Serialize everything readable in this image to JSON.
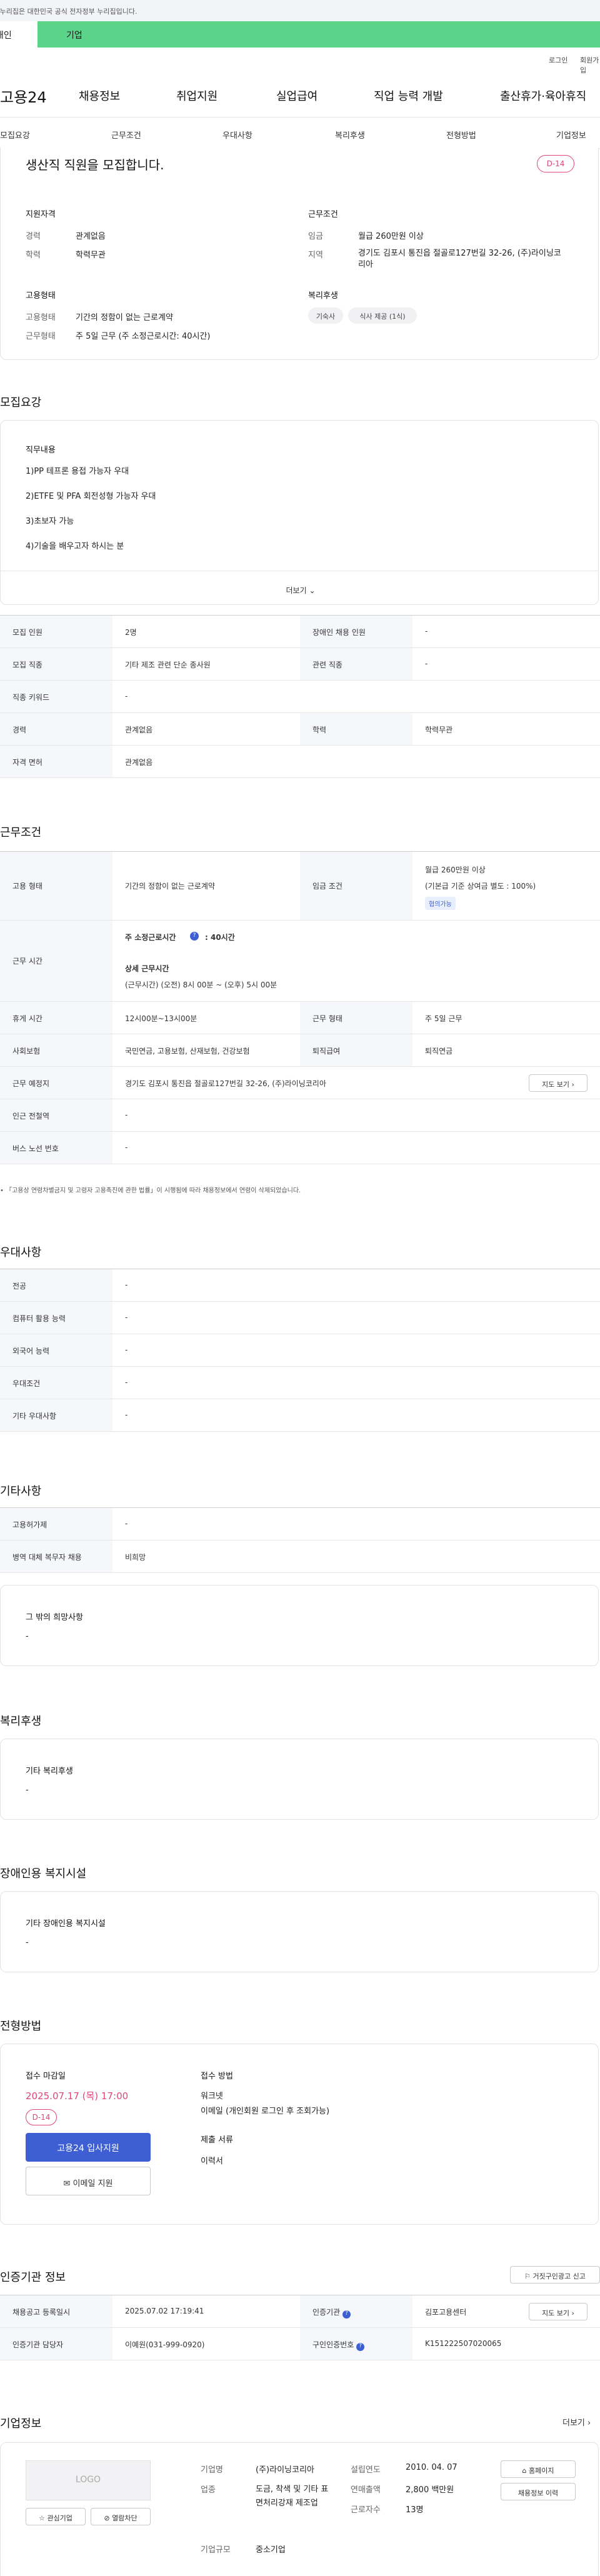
{
  "gov_banner": "이 누리집은 대한민국 공식 전자정부 누리집입니다.",
  "tabs": [
    "개인",
    "기업"
  ],
  "util": {
    "login": "로그인",
    "join": "회원가입"
  },
  "logo": "고용24",
  "gnb": [
    "채용정보",
    "취업지원",
    "실업급여",
    "직업 능력 개발",
    "출산휴가·육아휴직"
  ],
  "anchor_nav": [
    "모집요강",
    "근무조건",
    "우대사항",
    "복리후생",
    "전형방법",
    "기업정보"
  ],
  "summary": {
    "title": "생산직 직원을 모집합니다.",
    "dday": "D-14",
    "qual_title": "지원자격",
    "qual": [
      [
        "경력",
        "관계없음"
      ],
      [
        "학력",
        "학력무관"
      ]
    ],
    "cond_title": "근무조건",
    "cond": [
      [
        "임금",
        "월급 260만원 이상"
      ],
      [
        "지역",
        "경기도 김포시 통진읍 절골로127번길 32-26, (주)라이닝코리아"
      ]
    ],
    "emp_title": "고용형태",
    "emp": [
      [
        "고용형태",
        "기간의 정함이 없는 근로계약"
      ],
      [
        "근무형태",
        "주 5일 근무 (주 소정근로시간: 40시간)"
      ]
    ],
    "welfare_title": "복리후생",
    "welfare_chips": [
      "기숙사",
      "식사 제공 (1식)"
    ]
  },
  "recruit": {
    "heading": "모집요강",
    "duty_title": "직무내용",
    "duties": [
      "1)PP 테프론 용접 가능자 우대",
      "2)ETFE 및 PFA 회전성형 가능자 우대",
      "3)초보자 가능",
      "4)기술을 배우고자 하시는 분"
    ],
    "more": "더보기",
    "rows": [
      [
        "모집 인원",
        "2명",
        "장애인 채용 인원",
        "-"
      ],
      [
        "모집 직종",
        "기타 제조 관련 단순 종사원",
        "관련 직종",
        "-"
      ],
      [
        "직종 키워드",
        "-"
      ],
      [
        "경력",
        "관계없음",
        "학력",
        "학력무관"
      ],
      [
        "자격 면허",
        "관계없음"
      ]
    ]
  },
  "work": {
    "heading": "근무조건",
    "emp_label": "고용 형태",
    "emp_val": "기간의 정함이 없는 근로계약",
    "wage_label": "임금 조건",
    "wage_val": "월급 260만원 이상",
    "wage_note": "(기본급 기준 상여금 별도 : 100%)",
    "wage_chip": "협의가능",
    "time_label": "근무 시간",
    "weekly": "주 소정근로시간",
    "weekly_val": ": 40시간",
    "detail_title": "상세 근무시간",
    "detail_val": "(근무시간) (오전) 8시 00분 ~ (오후) 5시 00분",
    "rows": [
      [
        "휴게 시간",
        "12시00분~13시00분",
        "근무 형태",
        "주 5일 근무"
      ],
      [
        "사회보험",
        "국민연금, 고용보험, 산재보험, 건강보험",
        "퇴직급여",
        "퇴직연금"
      ]
    ],
    "place_label": "근무 예정지",
    "place_val": "경기도 김포시 통진읍 절골로127번길 32-26, (주)라이닝코리아",
    "map_btn": "지도 보기",
    "rows2": [
      [
        "인근 전철역",
        "-"
      ],
      [
        "버스 노선 번호",
        "-"
      ]
    ],
    "notice": "「고용상 연령차별금지 및 고령자 고용촉진에 관한 법률」이 시행됨에 따라 채용정보에서 연령이 삭제되었습니다."
  },
  "pref": {
    "heading": "우대사항",
    "rows": [
      [
        "전공",
        "-"
      ],
      [
        "컴퓨터 활용 능력",
        "-"
      ],
      [
        "외국어 능력",
        "-"
      ],
      [
        "우대조건",
        "-"
      ],
      [
        "기타 우대사항",
        "-"
      ]
    ]
  },
  "etc": {
    "heading": "기타사항",
    "rows": [
      [
        "고용허가제",
        "-"
      ],
      [
        "병역 대체 복무자 채용",
        "비희망"
      ]
    ],
    "other_title": "그 밖의 희망사항",
    "other_val": "-"
  },
  "benefit": {
    "heading": "복리후생",
    "title": "기타 복리후생",
    "val": "-"
  },
  "disabled": {
    "heading": "장애인용 복지시설",
    "title": "기타 장애인용 복지시설",
    "val": "-"
  },
  "process": {
    "heading": "전형방법",
    "deadline_title": "접수 마감일",
    "deadline": "2025.07.17 (목) 17:00",
    "dday": "D-14",
    "apply_btn": "고용24 입사지원",
    "email_btn": "이메일 지원",
    "method_title": "접수 방법",
    "method_vals": [
      "워크넷",
      "이메일 (개인회원 로그인 후 조회가능)"
    ],
    "docs_title": "제출 서류",
    "docs_val": "이력서"
  },
  "cert": {
    "heading": "인증기관 정보",
    "report_btn": "거짓구인광고 신고",
    "rows": [
      [
        "채용공고 등록일시",
        "2025.07.02 17:19:41",
        "인증기관",
        "김포고용센터"
      ],
      [
        "인증기관 담당자",
        "이예원(031-999-0920)",
        "구인인증번호",
        "K151222507020065"
      ]
    ],
    "map_btn": "지도 보기"
  },
  "company": {
    "heading": "기업정보",
    "more": "더보기",
    "logo": "LOGO",
    "fav_btn": "관심기업",
    "block_btn": "열람차단",
    "fields": [
      [
        "기업명",
        "(주)라이닝코리아"
      ],
      [
        "업종",
        "도금, 착색 및 기타 표면처리강재 제조업"
      ],
      [
        "기업규모",
        "중소기업"
      ]
    ],
    "fields2": [
      [
        "설립연도",
        "2010. 04. 07"
      ],
      [
        "연매출액",
        "2,800 백만원"
      ],
      [
        "근로자수",
        "13명"
      ]
    ],
    "home_btn": "홈페이지",
    "jobs_btn": "채용정보 이력"
  },
  "colors": {
    "accent": "#5bd48a",
    "primary": "#3e5fd4",
    "dday": "#e0457b"
  }
}
